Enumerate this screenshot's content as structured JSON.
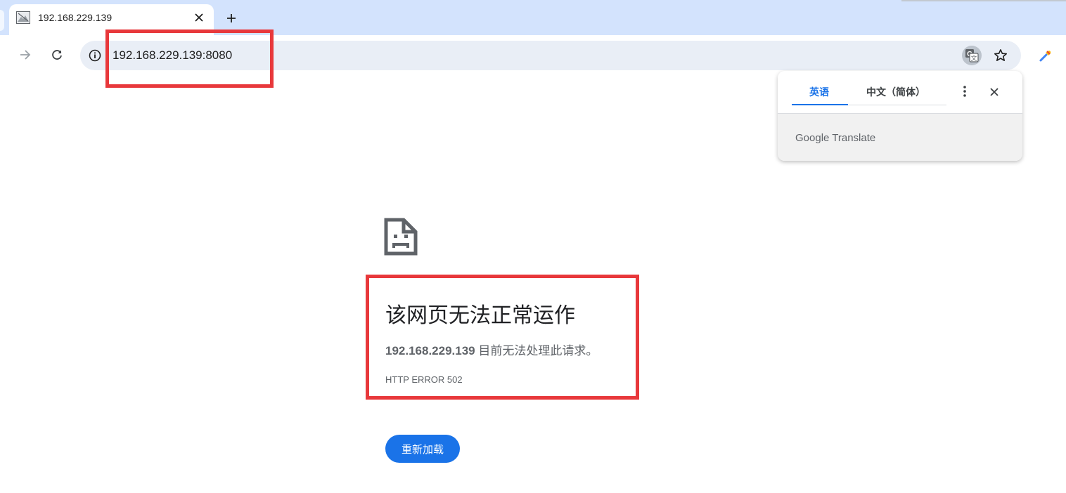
{
  "browser": {
    "tab": {
      "title": "192.168.229.139"
    },
    "address_bar": {
      "url": "192.168.229.139:8080"
    },
    "icons": {
      "favicon": "broken-image-icon",
      "tab_close": "close-icon",
      "new_tab": "plus-icon",
      "forward": "arrow-right-icon",
      "reload": "reload-icon",
      "site_info": "info-icon",
      "translate": "translate-icon",
      "bookmark": "star-icon",
      "extension": "eyedropper-icon"
    }
  },
  "translate_popup": {
    "tabs": [
      "英语",
      "中文（简体）"
    ],
    "active_tab": "英语",
    "brand": "Google Translate",
    "icons": {
      "menu": "more-vert-icon",
      "close": "close-icon"
    }
  },
  "error_page": {
    "icon": "sad-document-icon",
    "title": "该网页无法正常运作",
    "description_host": "192.168.229.139",
    "description_text": " 目前无法处理此请求。",
    "error_code": "HTTP ERROR 502",
    "reload_button": "重新加载"
  },
  "colors": {
    "tabstrip_bg": "#d3e3fd",
    "omnibox_bg": "#e9eef6",
    "accent": "#1a73e8",
    "annotation": "#e8383b"
  }
}
